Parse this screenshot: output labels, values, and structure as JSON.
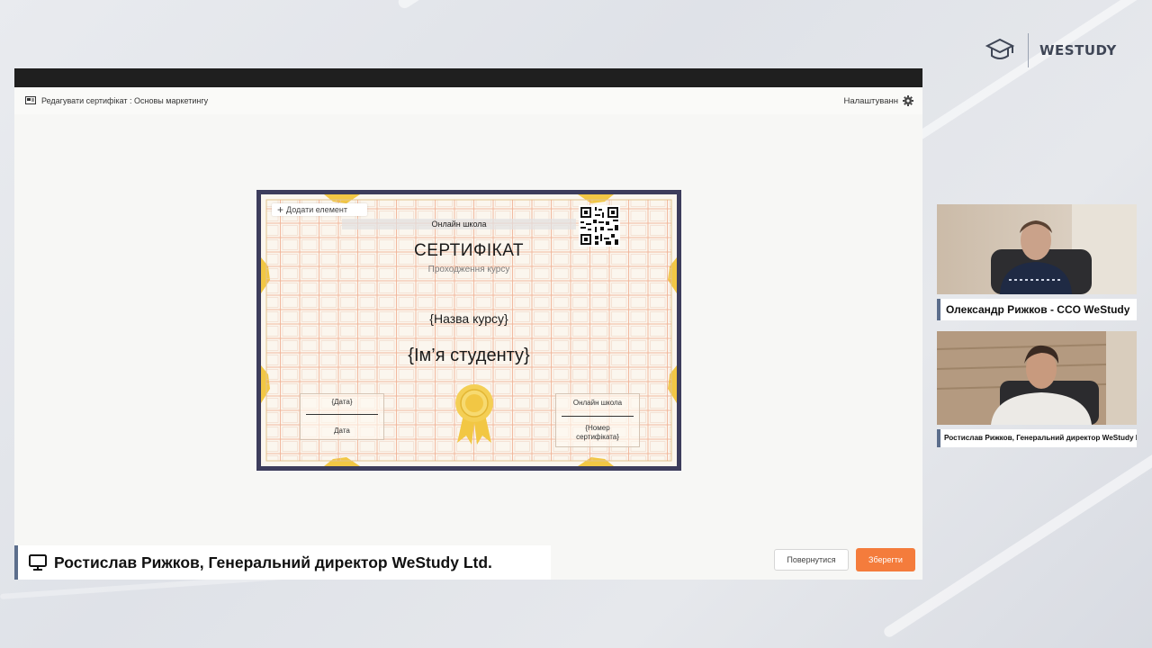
{
  "brand": {
    "name": "WESTUDY"
  },
  "app": {
    "title": "Редагувати сертифікат : Основы маркетингу",
    "settings_label": "Налаштуванн"
  },
  "certificate": {
    "add_element_label": "Додати елемент",
    "school_label": "Онлайн школа",
    "title": "СЕРТИФІКАТ",
    "subtitle": "Проходження курсу",
    "course_placeholder": "{Назва курсу}",
    "student_placeholder": "{Ім’я студенту}",
    "date_top": "{Дата}",
    "date_bottom": "Дата",
    "school_bottom": "Онлайн школа",
    "cert_number": "{Номер сертифіката}"
  },
  "buttons": {
    "back": "Повернутися",
    "save": "Зберегти"
  },
  "presenter_caption": "Ростислав Рижков, Генеральний директор WeStudy Ltd.",
  "participants": [
    {
      "label": "Олександр Рижков - CCO WeStudy"
    },
    {
      "label": "Ростислав Рижков, Генеральний директор WeStudy Ltd."
    }
  ],
  "colors": {
    "accent": "#f47c3c",
    "frame": "#3d3d5c",
    "gold": "#f2c744"
  }
}
